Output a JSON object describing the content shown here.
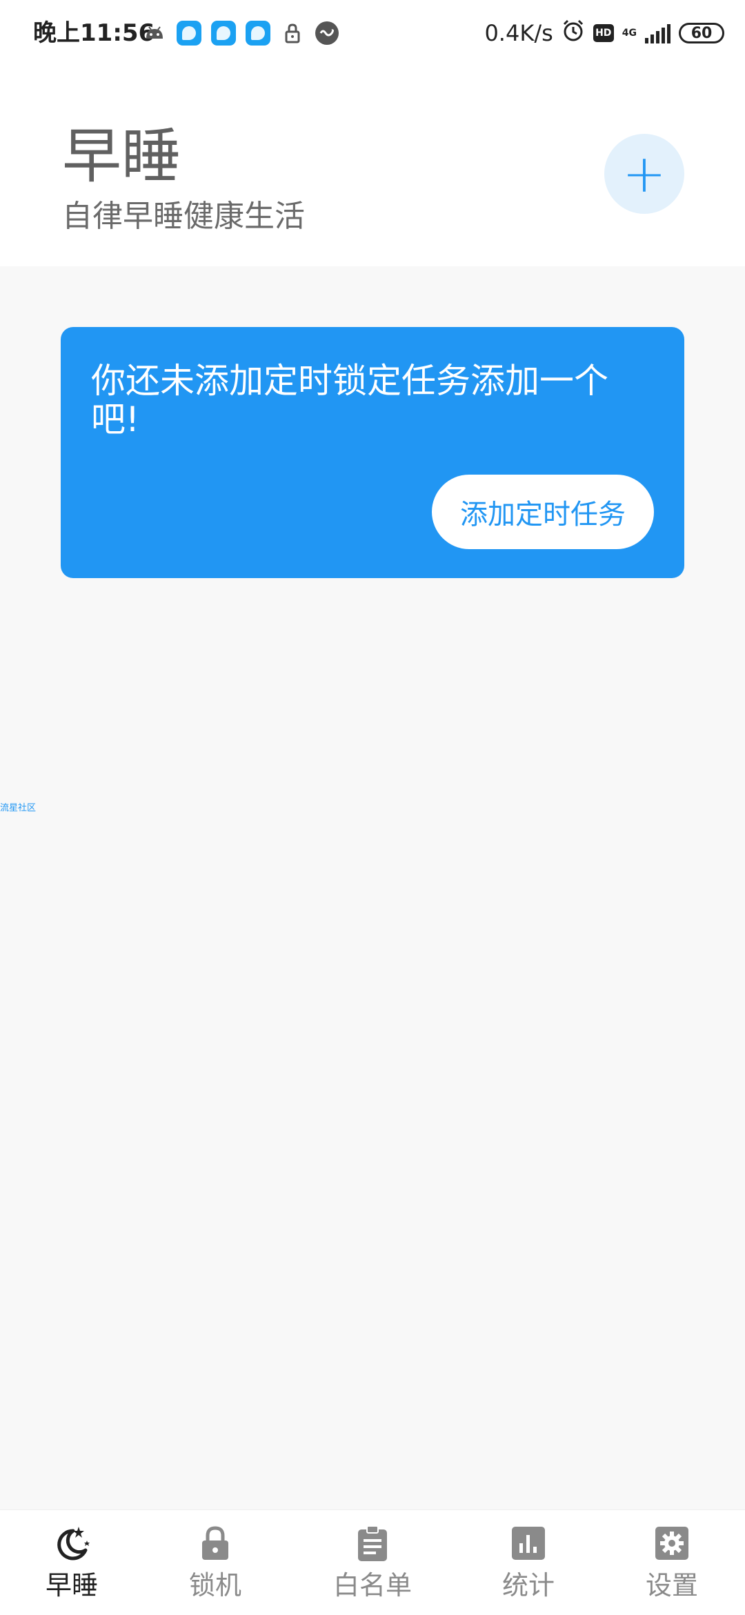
{
  "status_bar": {
    "time": "晚上11:56",
    "net_speed": "0.4K/s",
    "hd": "HD",
    "network": "4G",
    "battery": "60"
  },
  "header": {
    "title": "早睡",
    "subtitle": "自律早睡健康生活",
    "add_symbol": "+"
  },
  "card": {
    "message": "你还未添加定时锁定任务添加一个吧!",
    "button_label": "添加定时任务"
  },
  "watermark": "流星社区",
  "nav": {
    "items": [
      {
        "label": "早睡",
        "icon": "moon-stars-icon",
        "active": true
      },
      {
        "label": "锁机",
        "icon": "lock-icon",
        "active": false
      },
      {
        "label": "白名单",
        "icon": "clipboard-icon",
        "active": false
      },
      {
        "label": "统计",
        "icon": "bar-chart-icon",
        "active": false
      },
      {
        "label": "设置",
        "icon": "gear-icon",
        "active": false
      }
    ]
  },
  "colors": {
    "accent": "#2196F3",
    "fab_bg": "#E3F1FC",
    "background": "#F8F8F8"
  }
}
